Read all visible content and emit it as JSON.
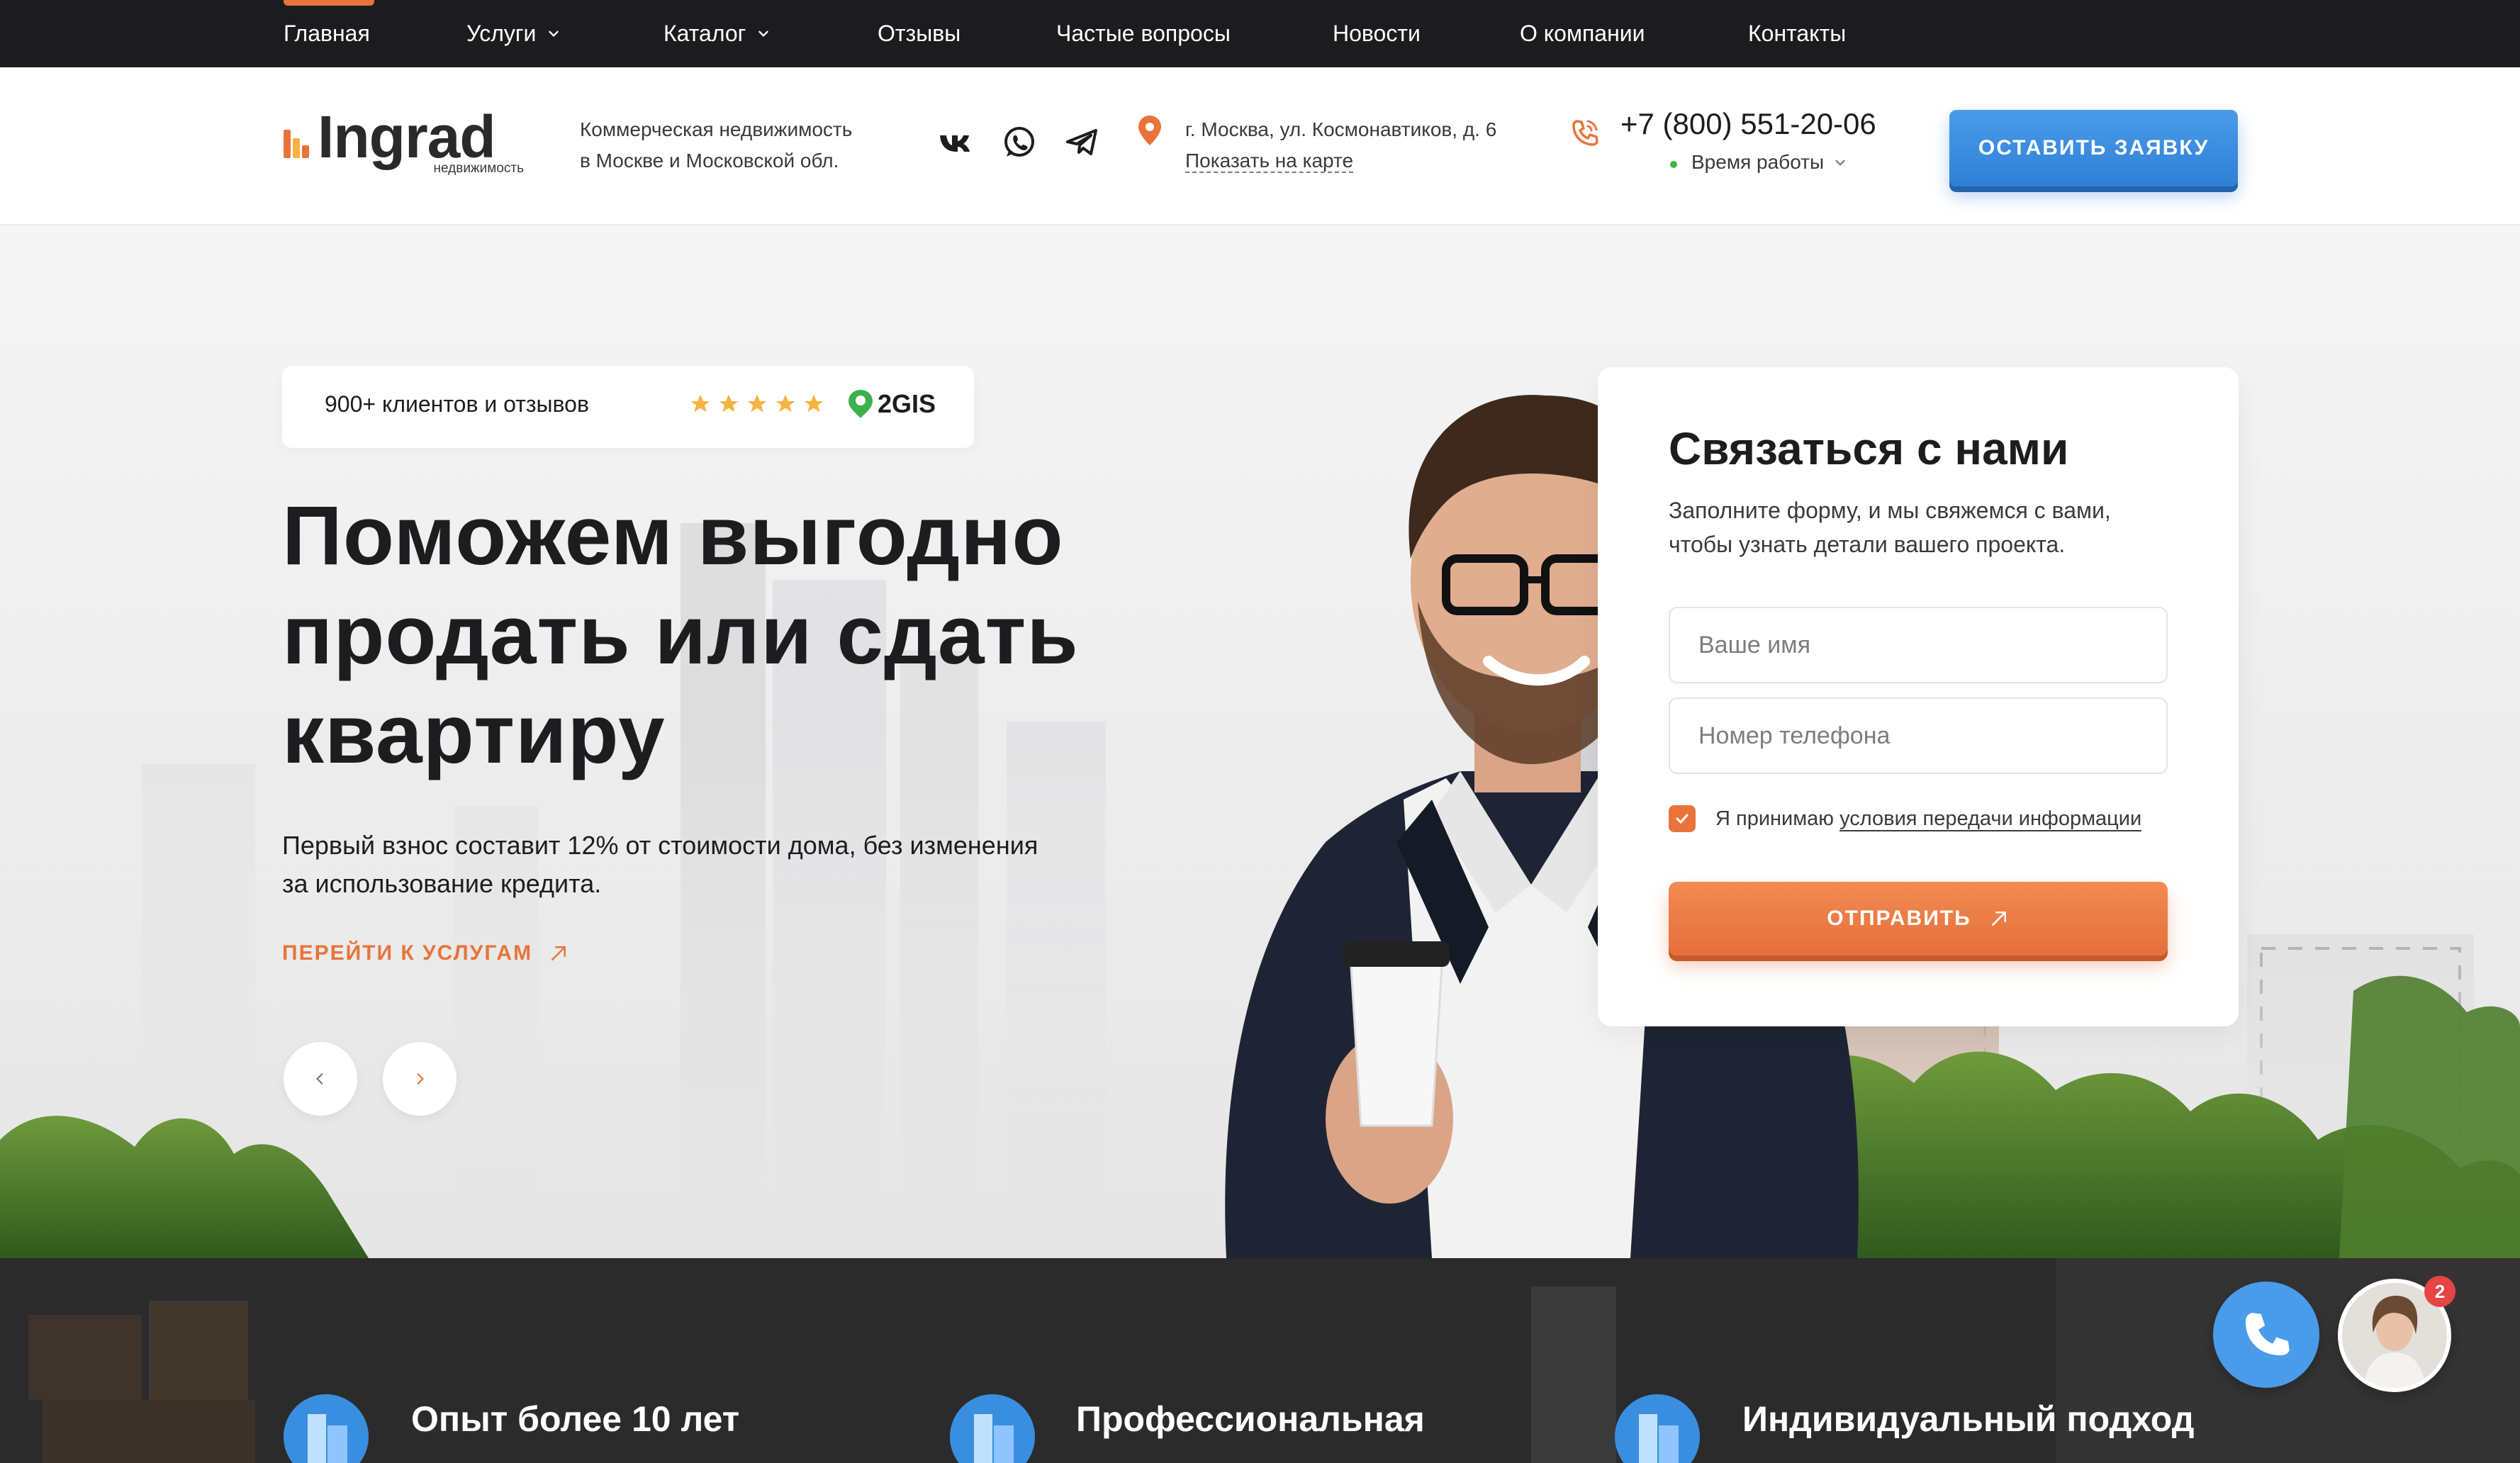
{
  "nav": {
    "items": [
      {
        "label": "Главная",
        "dropdown": false
      },
      {
        "label": "Услуги",
        "dropdown": true
      },
      {
        "label": "Каталог",
        "dropdown": true
      },
      {
        "label": "Отзывы",
        "dropdown": false
      },
      {
        "label": "Частые вопросы",
        "dropdown": false
      },
      {
        "label": "Новости",
        "dropdown": false
      },
      {
        "label": "О компании",
        "dropdown": false
      },
      {
        "label": "Контакты",
        "dropdown": false
      }
    ],
    "active_index": 0
  },
  "header": {
    "logo_text": "Ingrad",
    "logo_sub": "недвижимость",
    "tagline_line1": "Коммерческая недвижимость",
    "tagline_line2": "в Москве и Московской обл.",
    "social": [
      "vk-icon",
      "whatsapp-icon",
      "telegram-icon"
    ],
    "address": "г. Москва, ул. Космонавтиков, д. 6",
    "map_link": "Показать на карте",
    "phone": "+7 (800) 551-20-06",
    "hours_label": "Время работы",
    "cta": "ОСТАВИТЬ ЗАЯВКУ"
  },
  "hero": {
    "rating_text": "900+ клиентов и отзывов",
    "stars": 5,
    "rating_source": "2GIS",
    "title_line1": "Поможем выгодно",
    "title_line2": "продать или сдать",
    "title_line3": "квартиру",
    "subtitle_line1": "Первый взнос составит 12% от стоимости дома, без изменения",
    "subtitle_line2": "за использование кредита.",
    "link": "ПЕРЕЙТИ К УСЛУГАМ"
  },
  "form": {
    "title": "Связаться с нами",
    "desc_line1": "Заполните форму, и мы свяжемся с вами,",
    "desc_line2": "чтобы узнать детали вашего проекта.",
    "name_placeholder": "Ваше имя",
    "phone_placeholder": "Номер телефона",
    "consent_prefix": "Я принимаю",
    "consent_link": "условия передачи информации",
    "consent_checked": true,
    "submit": "ОТПРАВИТЬ"
  },
  "features": [
    {
      "title": "Опыт более 10 лет"
    },
    {
      "title": "Профессиональная"
    },
    {
      "title": "Индивидуальный подход"
    }
  ],
  "widgets": {
    "chat_badge": "2"
  },
  "colors": {
    "accent": "#e8743b",
    "primary_blue": "#3a8ee0",
    "nav_bg": "#1c1c1e",
    "dark_strip": "#2a2a2a"
  }
}
